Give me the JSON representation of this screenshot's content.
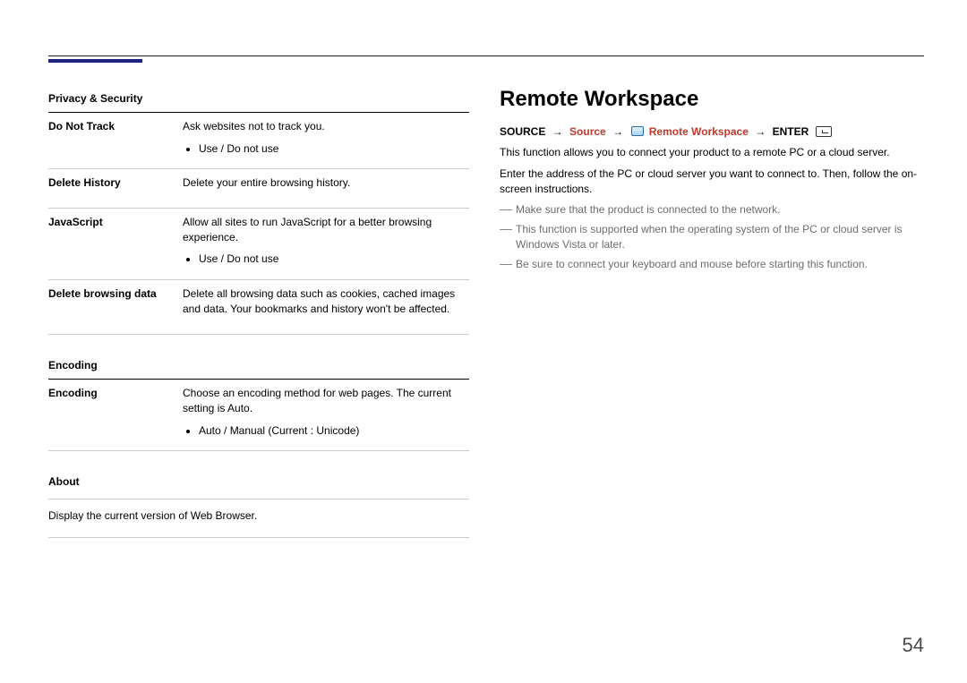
{
  "left": {
    "privacy": {
      "heading": "Privacy & Security",
      "rows": [
        {
          "label": "Do Not Track",
          "desc": "Ask websites not to track you.",
          "bullets": [
            "Use / Do not use"
          ]
        },
        {
          "label": "Delete History",
          "desc": "Delete your entire browsing history.",
          "bullets": []
        },
        {
          "label": "JavaScript",
          "desc": "Allow all sites to run JavaScript for a better browsing experience.",
          "bullets": [
            "Use / Do not use"
          ]
        },
        {
          "label": "Delete browsing data",
          "desc": "Delete all browsing data such as cookies, cached images and data. Your bookmarks and history won't be affected.",
          "bullets": []
        }
      ]
    },
    "encoding": {
      "heading": "Encoding",
      "rows": [
        {
          "label": "Encoding",
          "desc": "Choose an encoding method for web pages. The current setting is Auto.",
          "bullets": [
            "Auto / Manual (Current : Unicode)"
          ]
        }
      ]
    },
    "about": {
      "heading": "About",
      "text": "Display the current version of Web Browser."
    }
  },
  "right": {
    "title": "Remote Workspace",
    "path": {
      "source": "SOURCE",
      "menu": "Source",
      "item": "Remote Workspace",
      "enter": "ENTER"
    },
    "para1": "This function allows you to connect your product to a remote PC or a cloud server.",
    "para2": "Enter the address of the PC or cloud server you want to connect to. Then, follow the on-screen instructions.",
    "notes": [
      "Make sure that the product is connected to the network.",
      "This function is supported when the operating system of the PC or cloud server is Windows Vista or later.",
      "Be sure to connect your keyboard and mouse before starting this function."
    ]
  },
  "pageNumber": "54"
}
